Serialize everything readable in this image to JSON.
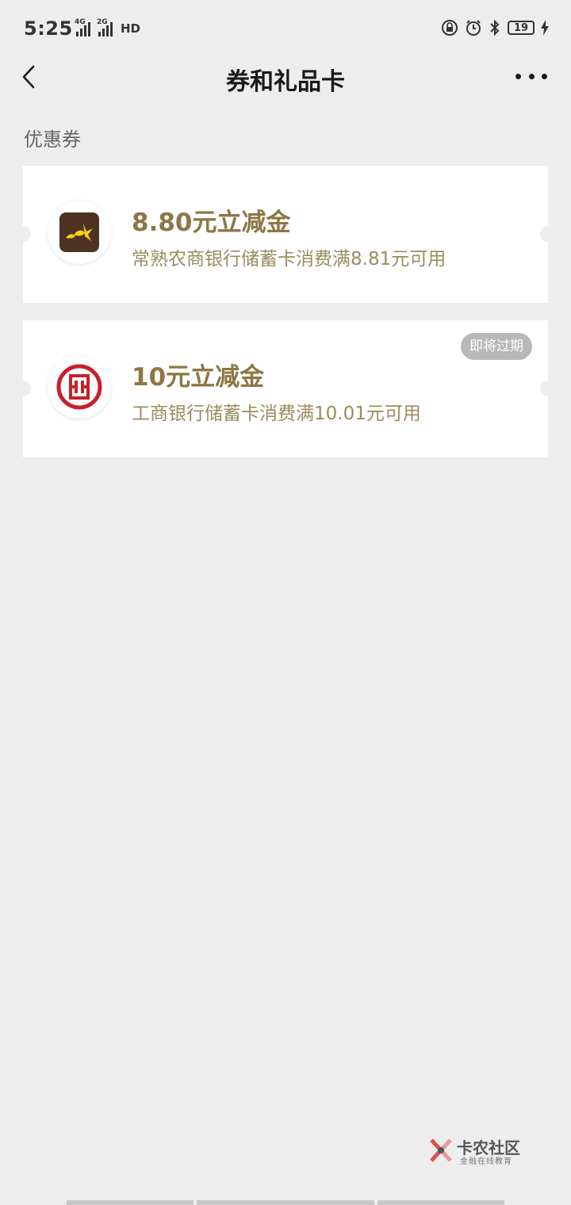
{
  "status_bar": {
    "time": "5:25",
    "network1": "4G",
    "network2": "2G",
    "hd": "HD",
    "battery": "19"
  },
  "nav": {
    "title": "券和礼品卡"
  },
  "section_title": "优惠券",
  "coupons": [
    {
      "title": "8.80元立减金",
      "desc": "常熟农商银行储蓄卡消费满8.81元可用",
      "bank_icon": "changshu-rural-bank-logo"
    },
    {
      "title": "10元立减金",
      "desc": "工商银行储蓄卡消费满10.01元可用",
      "bank_icon": "icbc-logo",
      "badge": "即将过期"
    }
  ],
  "watermark": {
    "main": "卡农社区",
    "sub": "金融在线教育"
  },
  "colors": {
    "accent_gold": "#8c7744",
    "background": "#ededed",
    "icbc_red": "#c8202b"
  }
}
